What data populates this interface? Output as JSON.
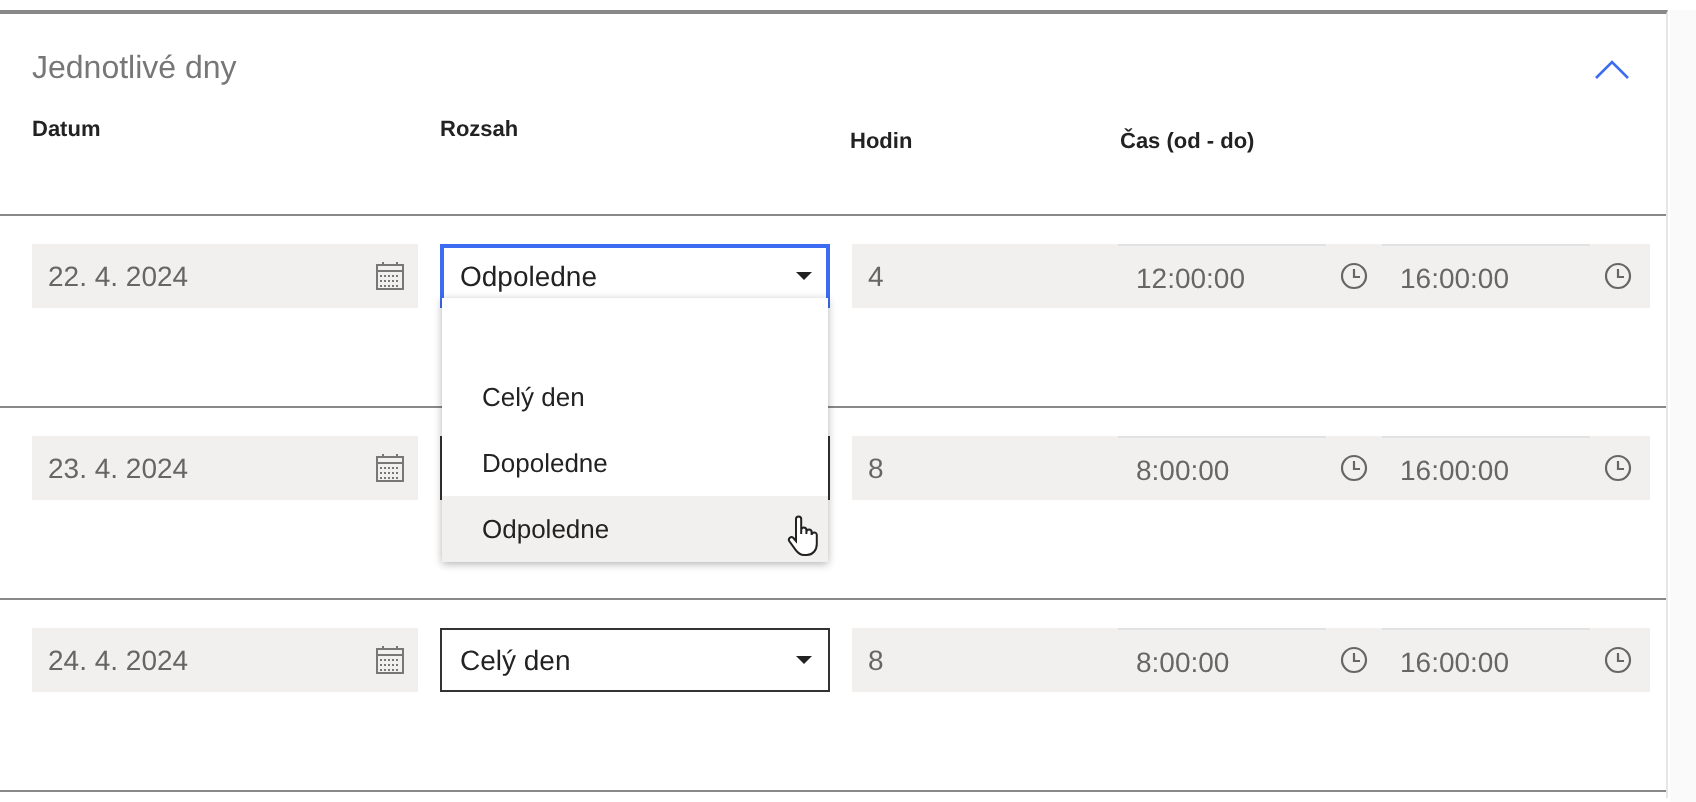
{
  "section": {
    "title": "Jednotlivé dny",
    "expanded": true
  },
  "columns": [
    "Datum",
    "Rozsah",
    "Hodin",
    "Čas (od - do)"
  ],
  "rows": [
    {
      "date": "22. 4. 2024",
      "range": "Odpoledne",
      "open": true,
      "hours": "4",
      "from": "12:00:00",
      "to": "16:00:00"
    },
    {
      "date": "23. 4. 2024",
      "open": false,
      "hours": "8",
      "from": "8:00:00",
      "to": "16:00:00"
    },
    {
      "date": "24. 4. 2024",
      "range": "Celý den",
      "open": false,
      "hours": "8",
      "from": "8:00:00",
      "to": "16:00:00"
    }
  ],
  "dropdown": {
    "options": [
      {
        "label": "Celý den",
        "selected": false
      },
      {
        "label": "Dopoledne",
        "selected": false
      },
      {
        "label": "Odpoledne",
        "selected": true
      }
    ]
  }
}
